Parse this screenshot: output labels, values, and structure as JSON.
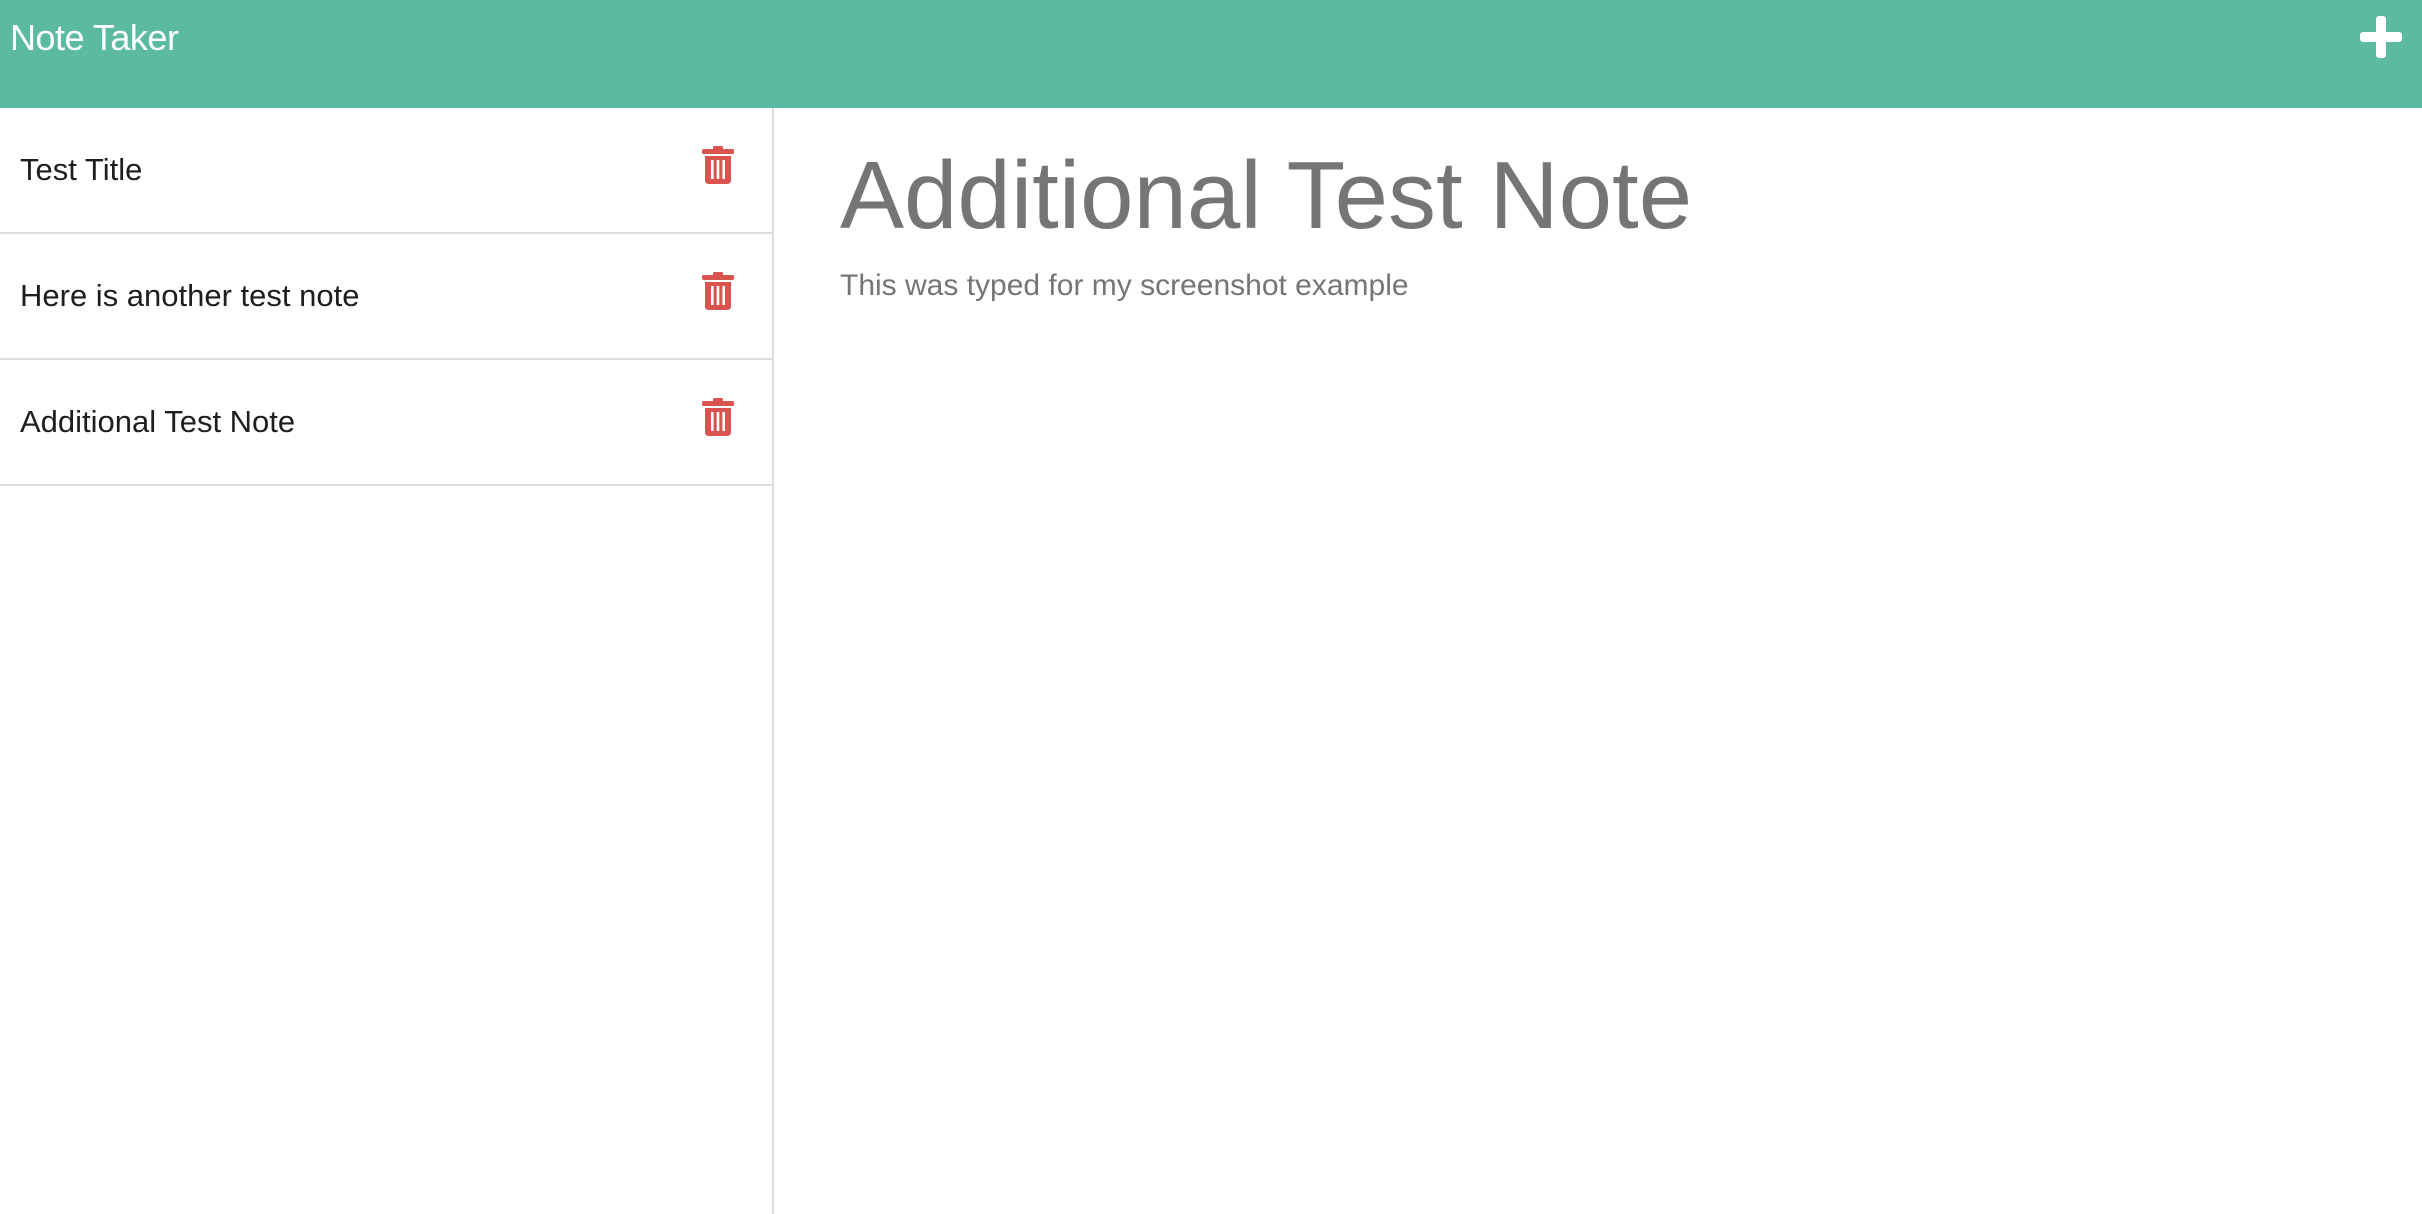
{
  "app": {
    "brand": "Note Taker",
    "accent_color": "#5bba9f",
    "new_note_icon": "plus-icon"
  },
  "sidebar": {
    "delete_icon": "trash-icon",
    "delete_color": "#d9534f",
    "notes": [
      {
        "title": "Test Title"
      },
      {
        "title": "Here is another test note"
      },
      {
        "title": "Additional Test Note"
      }
    ]
  },
  "active_note": {
    "title": "Additional Test Note",
    "text": "This was typed for my screenshot example"
  }
}
